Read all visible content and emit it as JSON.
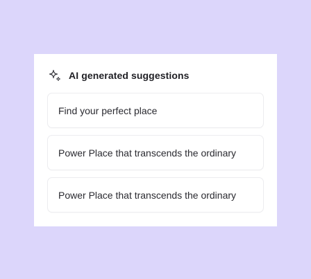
{
  "panel": {
    "title": "AI generated suggestions",
    "icon": "sparkle-icon",
    "suggestions": [
      "Find your perfect place",
      "Power Place that transcends the ordinary",
      "Power Place that transcends the ordinary"
    ]
  },
  "colors": {
    "background": "#dcd6fb",
    "panel": "#ffffff",
    "card_border": "#ececef",
    "text": "#2a2a30"
  }
}
